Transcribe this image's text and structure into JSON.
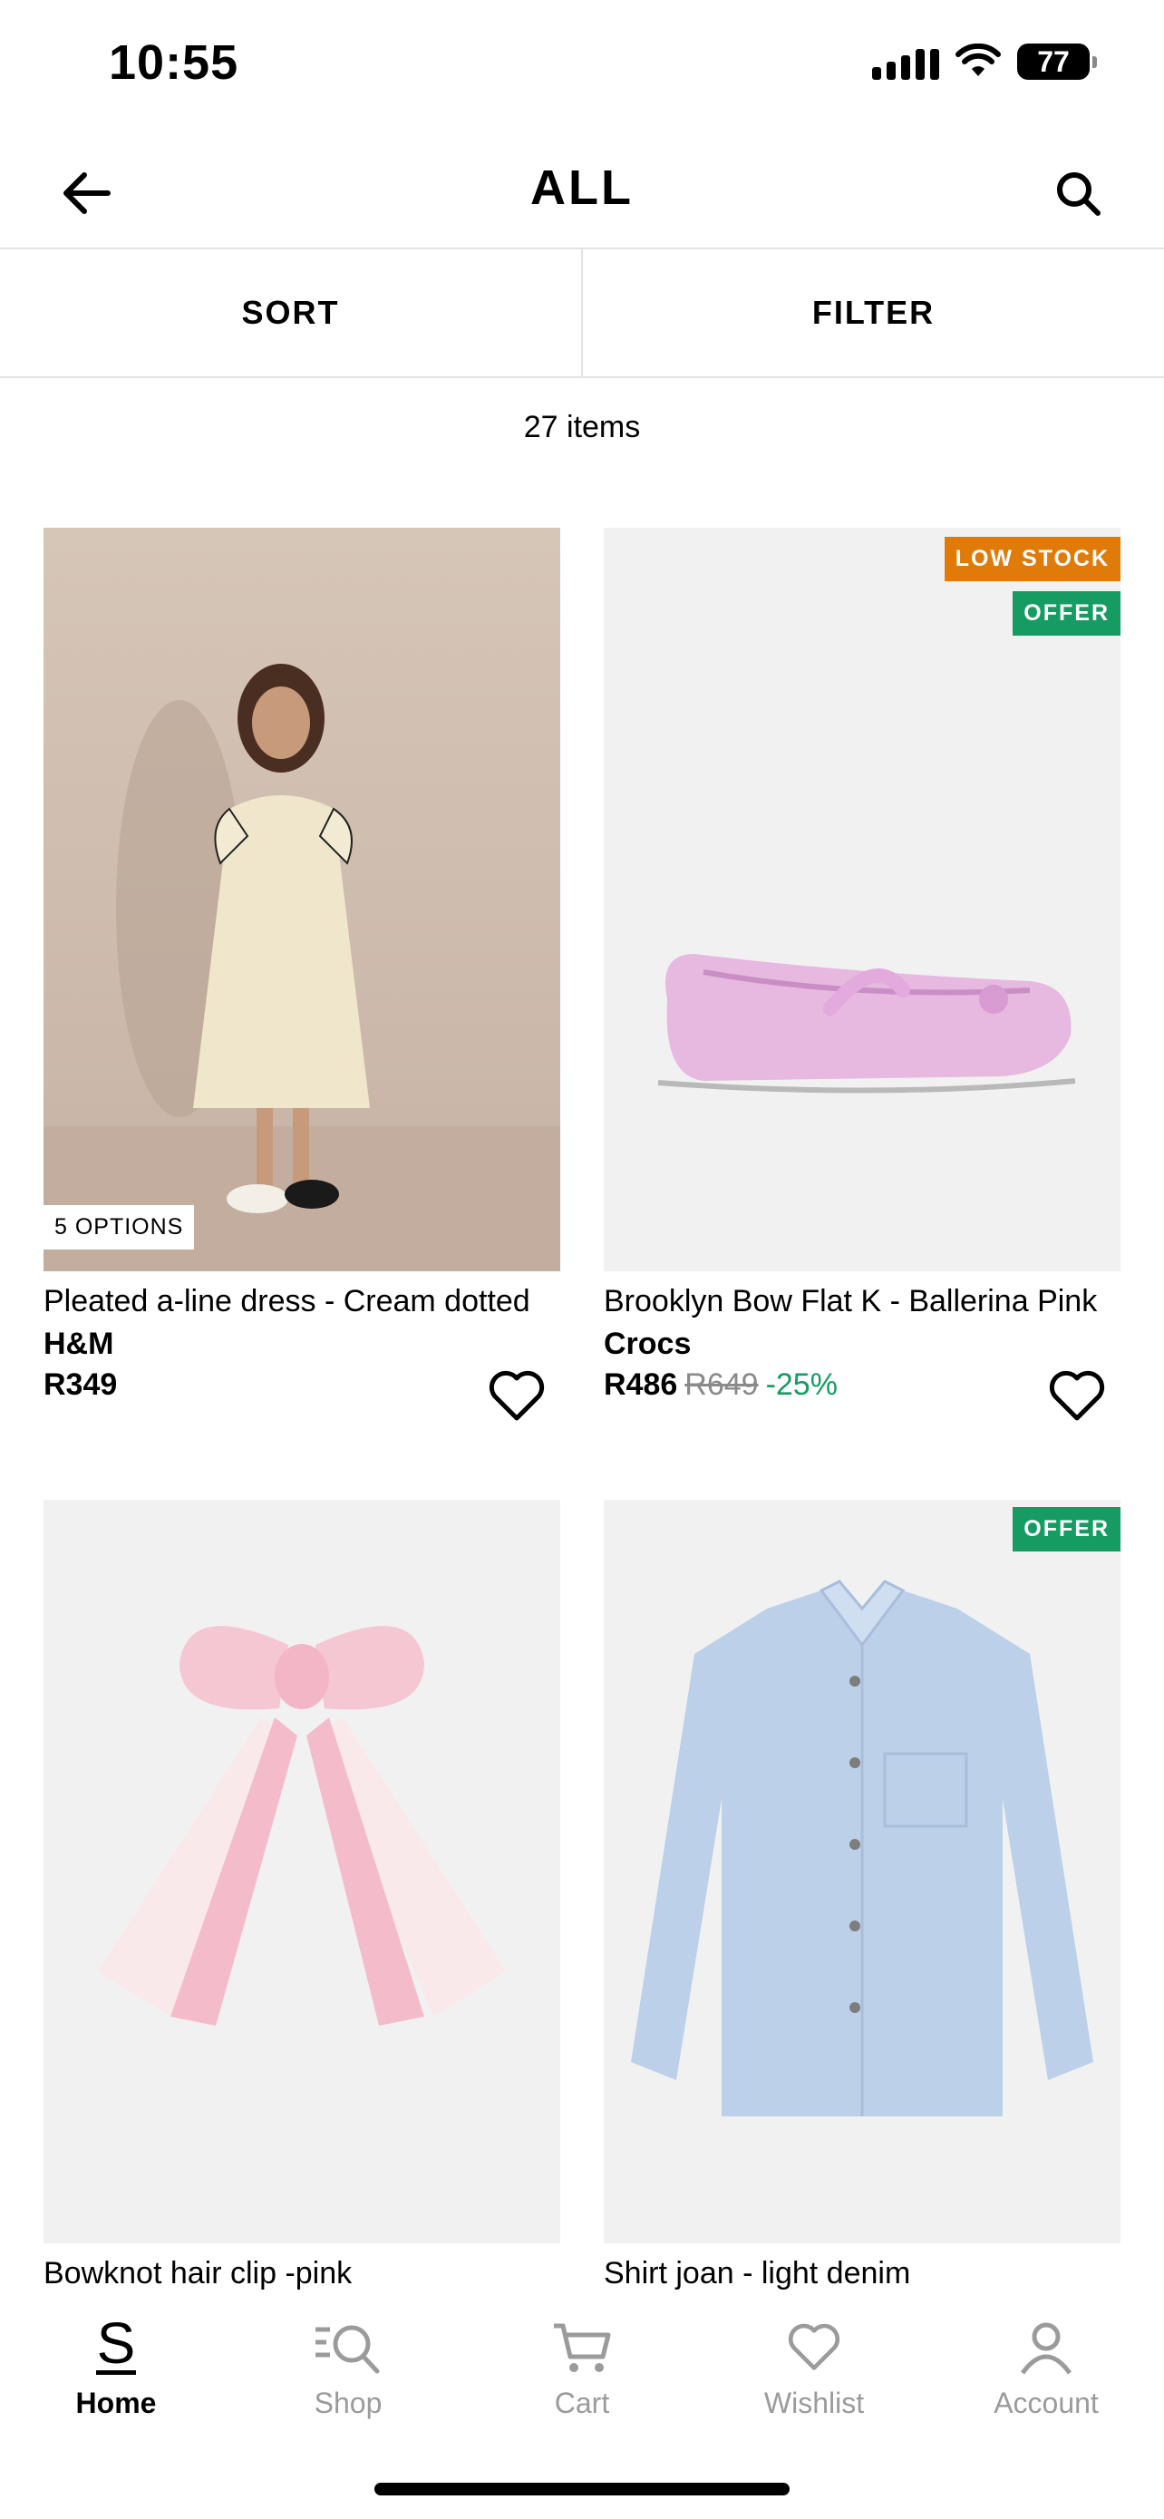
{
  "status_bar": {
    "time": "10:55",
    "battery": "77"
  },
  "header": {
    "title": "ALL"
  },
  "controls": {
    "sort": "SORT",
    "filter": "FILTER"
  },
  "item_count": "27 items",
  "products": [
    {
      "name": "Pleated a-line dress - Cream dotted",
      "brand": "H&M",
      "price": "R349",
      "options": "5 OPTIONS"
    },
    {
      "name": "Brooklyn Bow Flat K - Ballerina Pink",
      "brand": "Crocs",
      "price": "R486",
      "old_price": "R649",
      "discount": "-25%",
      "badges": [
        "LOW STOCK",
        "OFFER"
      ]
    },
    {
      "name": "Bowknot hair clip -pink"
    },
    {
      "name": "Shirt joan - light denim",
      "badges": [
        "OFFER"
      ]
    }
  ],
  "bottom_nav": [
    {
      "label": "Home",
      "icon": "home-s-icon"
    },
    {
      "label": "Shop",
      "icon": "shop-search-icon"
    },
    {
      "label": "Cart",
      "icon": "cart-icon"
    },
    {
      "label": "Wishlist",
      "icon": "heart-icon"
    },
    {
      "label": "Account",
      "icon": "person-icon"
    }
  ],
  "colors": {
    "low_stock": "#e07b0a",
    "offer": "#169c62",
    "discount": "#169c62",
    "inactive_nav": "#9b9b9b"
  }
}
